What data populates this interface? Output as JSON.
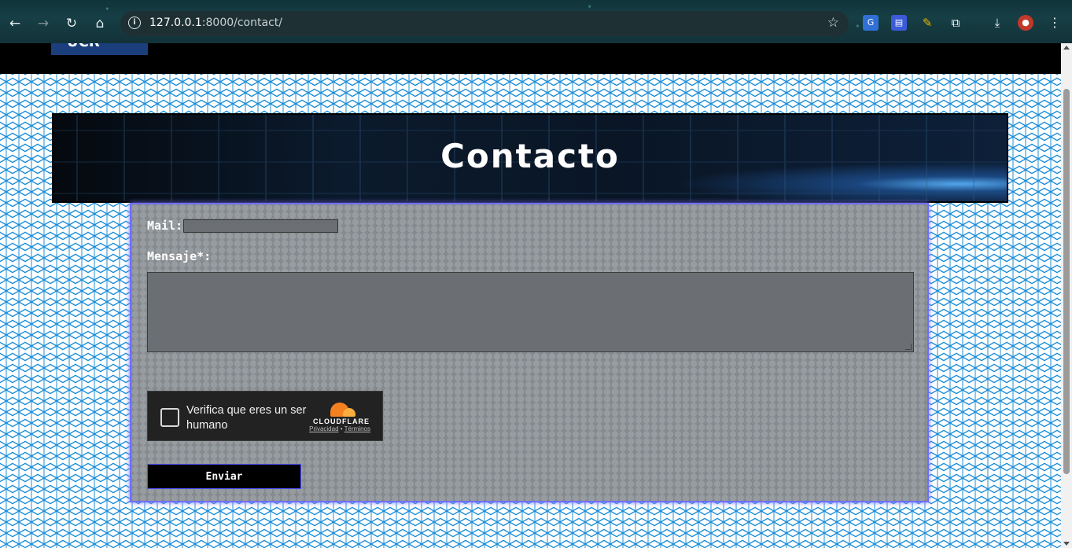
{
  "browser": {
    "url_host": "127.0.0.1",
    "url_rest": ":8000/contact/",
    "icons": [
      "back-icon",
      "forward-icon",
      "reload-icon",
      "home-icon",
      "info-icon",
      "bookmark-star-icon",
      "translate-icon",
      "extension-icon",
      "pen-icon",
      "puzzle-icon",
      "download-icon",
      "profile-avatar",
      "menu-icon"
    ]
  },
  "navbar": {
    "brand_label": "UCR"
  },
  "banner": {
    "title": "Contacto"
  },
  "form": {
    "mail_label": "Mail:",
    "mail_value": "",
    "message_label": "Mensaje*:",
    "message_value": "",
    "captcha": {
      "text": "Verifica que eres un ser humano",
      "brand": "CLOUDFLARE",
      "privacy_link": "Privacidad",
      "separator": "•",
      "terms_link": "Términos"
    },
    "submit_label": "Enviar"
  },
  "colors": {
    "card_border": "#6f6fff",
    "cloudflare_orange": "#f48120",
    "navbar": "#000000"
  }
}
